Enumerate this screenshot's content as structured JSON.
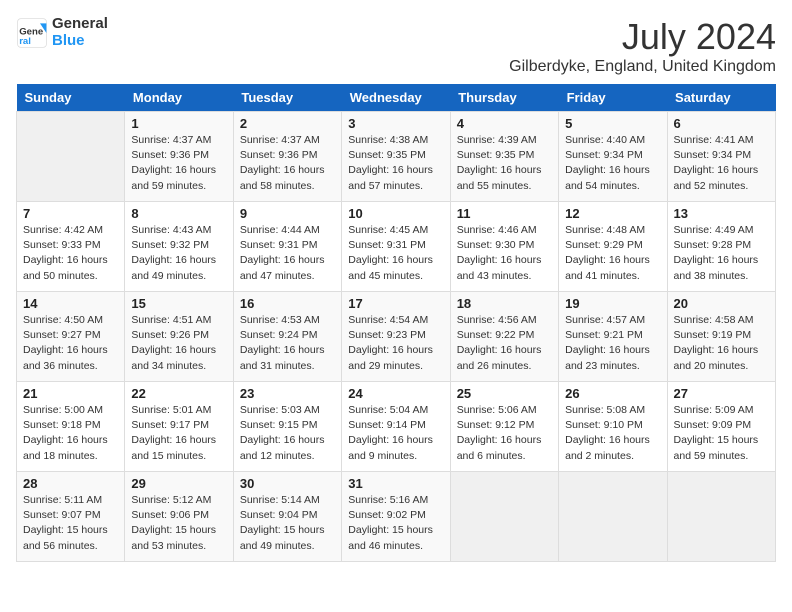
{
  "header": {
    "logo_general": "General",
    "logo_blue": "Blue",
    "month": "July 2024",
    "location": "Gilberdyke, England, United Kingdom"
  },
  "days_of_week": [
    "Sunday",
    "Monday",
    "Tuesday",
    "Wednesday",
    "Thursday",
    "Friday",
    "Saturday"
  ],
  "weeks": [
    [
      {
        "day": "",
        "info": ""
      },
      {
        "day": "1",
        "info": "Sunrise: 4:37 AM\nSunset: 9:36 PM\nDaylight: 16 hours and 59 minutes."
      },
      {
        "day": "2",
        "info": "Sunrise: 4:37 AM\nSunset: 9:36 PM\nDaylight: 16 hours and 58 minutes."
      },
      {
        "day": "3",
        "info": "Sunrise: 4:38 AM\nSunset: 9:35 PM\nDaylight: 16 hours and 57 minutes."
      },
      {
        "day": "4",
        "info": "Sunrise: 4:39 AM\nSunset: 9:35 PM\nDaylight: 16 hours and 55 minutes."
      },
      {
        "day": "5",
        "info": "Sunrise: 4:40 AM\nSunset: 9:34 PM\nDaylight: 16 hours and 54 minutes."
      },
      {
        "day": "6",
        "info": "Sunrise: 4:41 AM\nSunset: 9:34 PM\nDaylight: 16 hours and 52 minutes."
      }
    ],
    [
      {
        "day": "7",
        "info": "Sunrise: 4:42 AM\nSunset: 9:33 PM\nDaylight: 16 hours and 50 minutes."
      },
      {
        "day": "8",
        "info": "Sunrise: 4:43 AM\nSunset: 9:32 PM\nDaylight: 16 hours and 49 minutes."
      },
      {
        "day": "9",
        "info": "Sunrise: 4:44 AM\nSunset: 9:31 PM\nDaylight: 16 hours and 47 minutes."
      },
      {
        "day": "10",
        "info": "Sunrise: 4:45 AM\nSunset: 9:31 PM\nDaylight: 16 hours and 45 minutes."
      },
      {
        "day": "11",
        "info": "Sunrise: 4:46 AM\nSunset: 9:30 PM\nDaylight: 16 hours and 43 minutes."
      },
      {
        "day": "12",
        "info": "Sunrise: 4:48 AM\nSunset: 9:29 PM\nDaylight: 16 hours and 41 minutes."
      },
      {
        "day": "13",
        "info": "Sunrise: 4:49 AM\nSunset: 9:28 PM\nDaylight: 16 hours and 38 minutes."
      }
    ],
    [
      {
        "day": "14",
        "info": "Sunrise: 4:50 AM\nSunset: 9:27 PM\nDaylight: 16 hours and 36 minutes."
      },
      {
        "day": "15",
        "info": "Sunrise: 4:51 AM\nSunset: 9:26 PM\nDaylight: 16 hours and 34 minutes."
      },
      {
        "day": "16",
        "info": "Sunrise: 4:53 AM\nSunset: 9:24 PM\nDaylight: 16 hours and 31 minutes."
      },
      {
        "day": "17",
        "info": "Sunrise: 4:54 AM\nSunset: 9:23 PM\nDaylight: 16 hours and 29 minutes."
      },
      {
        "day": "18",
        "info": "Sunrise: 4:56 AM\nSunset: 9:22 PM\nDaylight: 16 hours and 26 minutes."
      },
      {
        "day": "19",
        "info": "Sunrise: 4:57 AM\nSunset: 9:21 PM\nDaylight: 16 hours and 23 minutes."
      },
      {
        "day": "20",
        "info": "Sunrise: 4:58 AM\nSunset: 9:19 PM\nDaylight: 16 hours and 20 minutes."
      }
    ],
    [
      {
        "day": "21",
        "info": "Sunrise: 5:00 AM\nSunset: 9:18 PM\nDaylight: 16 hours and 18 minutes."
      },
      {
        "day": "22",
        "info": "Sunrise: 5:01 AM\nSunset: 9:17 PM\nDaylight: 16 hours and 15 minutes."
      },
      {
        "day": "23",
        "info": "Sunrise: 5:03 AM\nSunset: 9:15 PM\nDaylight: 16 hours and 12 minutes."
      },
      {
        "day": "24",
        "info": "Sunrise: 5:04 AM\nSunset: 9:14 PM\nDaylight: 16 hours and 9 minutes."
      },
      {
        "day": "25",
        "info": "Sunrise: 5:06 AM\nSunset: 9:12 PM\nDaylight: 16 hours and 6 minutes."
      },
      {
        "day": "26",
        "info": "Sunrise: 5:08 AM\nSunset: 9:10 PM\nDaylight: 16 hours and 2 minutes."
      },
      {
        "day": "27",
        "info": "Sunrise: 5:09 AM\nSunset: 9:09 PM\nDaylight: 15 hours and 59 minutes."
      }
    ],
    [
      {
        "day": "28",
        "info": "Sunrise: 5:11 AM\nSunset: 9:07 PM\nDaylight: 15 hours and 56 minutes."
      },
      {
        "day": "29",
        "info": "Sunrise: 5:12 AM\nSunset: 9:06 PM\nDaylight: 15 hours and 53 minutes."
      },
      {
        "day": "30",
        "info": "Sunrise: 5:14 AM\nSunset: 9:04 PM\nDaylight: 15 hours and 49 minutes."
      },
      {
        "day": "31",
        "info": "Sunrise: 5:16 AM\nSunset: 9:02 PM\nDaylight: 15 hours and 46 minutes."
      },
      {
        "day": "",
        "info": ""
      },
      {
        "day": "",
        "info": ""
      },
      {
        "day": "",
        "info": ""
      }
    ]
  ]
}
